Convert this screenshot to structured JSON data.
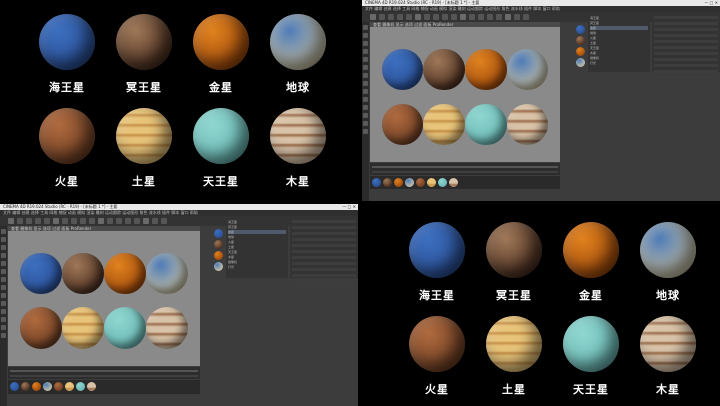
{
  "planets": [
    {
      "key": "neptune",
      "label": "海王星",
      "color": "#3c6fbf",
      "color2": "#2a4f95"
    },
    {
      "key": "pluto",
      "label": "冥王星",
      "color": "#a07858",
      "color2": "#4b2f20"
    },
    {
      "key": "venus",
      "label": "金星",
      "color": "#e0821e",
      "color2": "#a04a0c"
    },
    {
      "key": "earth",
      "label": "地球",
      "color": "#4f7cb8",
      "color2": "#c9c2a6"
    },
    {
      "key": "mars",
      "label": "火星",
      "color": "#b06a3e",
      "color2": "#6e3f24"
    },
    {
      "key": "saturn",
      "label": "土星",
      "color": "#e8c47a",
      "color2": "#c59048"
    },
    {
      "key": "uranus",
      "label": "天王星",
      "color": "#8fd6d0",
      "color2": "#6ab8b4"
    },
    {
      "key": "jupiter",
      "label": "木星",
      "color": "#d9c3a8",
      "color2": "#9a6b4a"
    }
  ],
  "editor": {
    "title": "CINEMA 4D R19.024 Studio (RC - R19) - [未标题 1 *] - 主要",
    "menu": "文件  编辑  创建  选择  工具  网格  捕捉  动画  模拟  渲染  雕刻  运动跟踪  运动图形  角色  流水线  插件  脚本  窗口  帮助",
    "viewport_menu": "查看  摄像机  显示  选项  过滤  面板  ProRender",
    "window_controls": "—  □  ✕",
    "objects": [
      "海王星",
      "冥王星",
      "金星",
      "地球",
      "火星",
      "土星",
      "天王星",
      "木星",
      "摄像机",
      "灯光"
    ],
    "selected_object_index": 2
  },
  "colors": {
    "editor_bg": "#3c3c3c",
    "viewport_bg": "#8a8a8a",
    "screen_bg": "#000000"
  }
}
